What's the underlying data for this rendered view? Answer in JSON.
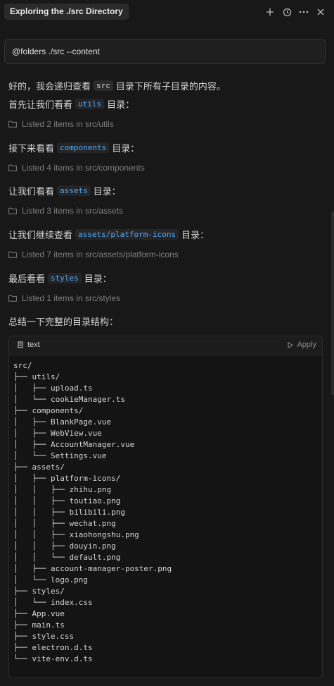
{
  "header": {
    "title": "Exploring the ./src Directory",
    "actions": [
      {
        "name": "new-chat-icon",
        "glyph": "+"
      },
      {
        "name": "history-icon",
        "glyph": "history"
      },
      {
        "name": "more-icon",
        "glyph": "···"
      },
      {
        "name": "close-icon",
        "glyph": "×"
      }
    ]
  },
  "input": {
    "value": "@folders ./src --content"
  },
  "messages": {
    "intro_pre": "好的，我会递归查看",
    "intro_code": "src",
    "intro_post": "目录下所有子目录的内容。",
    "utils_pre": "首先让我们看看",
    "utils_code": "utils",
    "utils_post": "目录：",
    "utils_listed": "Listed 2 items in src/utils",
    "components_pre": "接下来看看",
    "components_code": "components",
    "components_post": "目录：",
    "components_listed": "Listed 4 items in src/components",
    "assets_pre": "让我们看看",
    "assets_code": "assets",
    "assets_post": "目录：",
    "assets_listed": "Listed 3 items in src/assets",
    "icons_pre": "让我们继续查看",
    "icons_code": "assets/platform-icons",
    "icons_post": "目录：",
    "icons_listed": "Listed 7 items in src/assets/platform-icons",
    "styles_pre": "最后看看",
    "styles_code": "styles",
    "styles_post": "目录：",
    "styles_listed": "Listed 1 items in src/styles",
    "summary": "总结一下完整的目录结构："
  },
  "code_block": {
    "language": "text",
    "apply_label": "Apply",
    "lines": [
      "src/",
      "├── utils/",
      "│   ├── upload.ts",
      "│   └── cookieManager.ts",
      "├── components/",
      "│   ├── BlankPage.vue",
      "│   ├── WebView.vue",
      "│   ├── AccountManager.vue",
      "│   └── Settings.vue",
      "├── assets/",
      "│   ├── platform-icons/",
      "│   │   ├── zhihu.png",
      "│   │   ├── toutiao.png",
      "│   │   ├── bilibili.png",
      "│   │   ├── wechat.png",
      "│   │   ├── xiaohongshu.png",
      "│   │   ├── douyin.png",
      "│   │   └── default.png",
      "│   ├── account-manager-poster.png",
      "│   └── logo.png",
      "├── styles/",
      "│   └── index.css",
      "├── App.vue",
      "├── main.ts",
      "├── style.css",
      "├── electron.d.ts",
      "└── vite-env.d.ts"
    ]
  },
  "colors": {
    "background": "#181818",
    "accent_code": "#4daafc",
    "muted": "#7d7d7d"
  }
}
